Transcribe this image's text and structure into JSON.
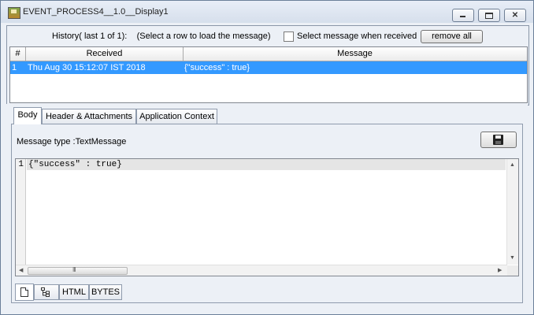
{
  "window": {
    "title": "EVENT_PROCESS4__1.0__Display1"
  },
  "window_controls": {
    "minimize": "",
    "maximize": "",
    "close": "✕"
  },
  "history": {
    "label": "History( last 1 of 1):    (Select a row to load the message)",
    "select_when_received_label": "Select message when received",
    "select_when_received_checked": false,
    "remove_all_label": "remove all"
  },
  "table": {
    "columns": [
      "#",
      "Received",
      "Message"
    ],
    "rows": [
      {
        "num": "1",
        "received": "Thu Aug 30 15:12:07 IST 2018",
        "message": "{\"success\" : true}",
        "selected": true
      }
    ]
  },
  "tabs": [
    {
      "label": "Body",
      "active": true
    },
    {
      "label": "Header & Attachments",
      "active": false
    },
    {
      "label": "Application Context",
      "active": false
    }
  ],
  "body": {
    "message_type": "Message type :TextMessage",
    "save_icon": "floppy-disk",
    "lines": [
      {
        "number": "1",
        "text": "{\"success\" : true}"
      }
    ],
    "scroll_grip": "III"
  },
  "view_tabs": [
    {
      "label": "",
      "icon": "document-icon",
      "active": true
    },
    {
      "label": "",
      "icon": "tree-icon",
      "active": false
    },
    {
      "label": "HTML",
      "active": false
    },
    {
      "label": "BYTES",
      "active": false
    }
  ],
  "colors": {
    "selection": "#3399ff",
    "window_bg": "#ecf0f6"
  }
}
